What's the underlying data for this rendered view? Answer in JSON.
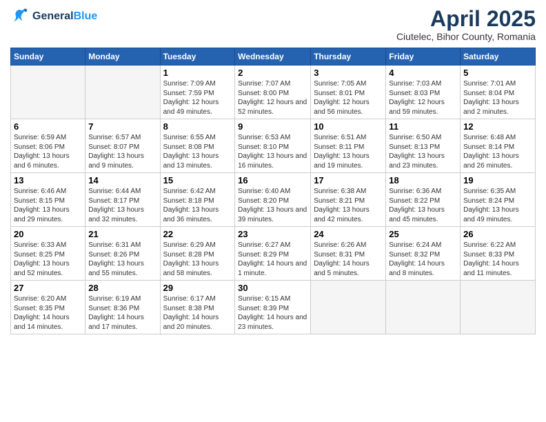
{
  "header": {
    "logo_line1": "General",
    "logo_line2": "Blue",
    "month": "April 2025",
    "location": "Ciutelec, Bihor County, Romania"
  },
  "days_of_week": [
    "Sunday",
    "Monday",
    "Tuesday",
    "Wednesday",
    "Thursday",
    "Friday",
    "Saturday"
  ],
  "weeks": [
    [
      {
        "day": "",
        "info": ""
      },
      {
        "day": "",
        "info": ""
      },
      {
        "day": "1",
        "info": "Sunrise: 7:09 AM\nSunset: 7:59 PM\nDaylight: 12 hours and 49 minutes."
      },
      {
        "day": "2",
        "info": "Sunrise: 7:07 AM\nSunset: 8:00 PM\nDaylight: 12 hours and 52 minutes."
      },
      {
        "day": "3",
        "info": "Sunrise: 7:05 AM\nSunset: 8:01 PM\nDaylight: 12 hours and 56 minutes."
      },
      {
        "day": "4",
        "info": "Sunrise: 7:03 AM\nSunset: 8:03 PM\nDaylight: 12 hours and 59 minutes."
      },
      {
        "day": "5",
        "info": "Sunrise: 7:01 AM\nSunset: 8:04 PM\nDaylight: 13 hours and 2 minutes."
      }
    ],
    [
      {
        "day": "6",
        "info": "Sunrise: 6:59 AM\nSunset: 8:06 PM\nDaylight: 13 hours and 6 minutes."
      },
      {
        "day": "7",
        "info": "Sunrise: 6:57 AM\nSunset: 8:07 PM\nDaylight: 13 hours and 9 minutes."
      },
      {
        "day": "8",
        "info": "Sunrise: 6:55 AM\nSunset: 8:08 PM\nDaylight: 13 hours and 13 minutes."
      },
      {
        "day": "9",
        "info": "Sunrise: 6:53 AM\nSunset: 8:10 PM\nDaylight: 13 hours and 16 minutes."
      },
      {
        "day": "10",
        "info": "Sunrise: 6:51 AM\nSunset: 8:11 PM\nDaylight: 13 hours and 19 minutes."
      },
      {
        "day": "11",
        "info": "Sunrise: 6:50 AM\nSunset: 8:13 PM\nDaylight: 13 hours and 23 minutes."
      },
      {
        "day": "12",
        "info": "Sunrise: 6:48 AM\nSunset: 8:14 PM\nDaylight: 13 hours and 26 minutes."
      }
    ],
    [
      {
        "day": "13",
        "info": "Sunrise: 6:46 AM\nSunset: 8:15 PM\nDaylight: 13 hours and 29 minutes."
      },
      {
        "day": "14",
        "info": "Sunrise: 6:44 AM\nSunset: 8:17 PM\nDaylight: 13 hours and 32 minutes."
      },
      {
        "day": "15",
        "info": "Sunrise: 6:42 AM\nSunset: 8:18 PM\nDaylight: 13 hours and 36 minutes."
      },
      {
        "day": "16",
        "info": "Sunrise: 6:40 AM\nSunset: 8:20 PM\nDaylight: 13 hours and 39 minutes."
      },
      {
        "day": "17",
        "info": "Sunrise: 6:38 AM\nSunset: 8:21 PM\nDaylight: 13 hours and 42 minutes."
      },
      {
        "day": "18",
        "info": "Sunrise: 6:36 AM\nSunset: 8:22 PM\nDaylight: 13 hours and 45 minutes."
      },
      {
        "day": "19",
        "info": "Sunrise: 6:35 AM\nSunset: 8:24 PM\nDaylight: 13 hours and 49 minutes."
      }
    ],
    [
      {
        "day": "20",
        "info": "Sunrise: 6:33 AM\nSunset: 8:25 PM\nDaylight: 13 hours and 52 minutes."
      },
      {
        "day": "21",
        "info": "Sunrise: 6:31 AM\nSunset: 8:26 PM\nDaylight: 13 hours and 55 minutes."
      },
      {
        "day": "22",
        "info": "Sunrise: 6:29 AM\nSunset: 8:28 PM\nDaylight: 13 hours and 58 minutes."
      },
      {
        "day": "23",
        "info": "Sunrise: 6:27 AM\nSunset: 8:29 PM\nDaylight: 14 hours and 1 minute."
      },
      {
        "day": "24",
        "info": "Sunrise: 6:26 AM\nSunset: 8:31 PM\nDaylight: 14 hours and 5 minutes."
      },
      {
        "day": "25",
        "info": "Sunrise: 6:24 AM\nSunset: 8:32 PM\nDaylight: 14 hours and 8 minutes."
      },
      {
        "day": "26",
        "info": "Sunrise: 6:22 AM\nSunset: 8:33 PM\nDaylight: 14 hours and 11 minutes."
      }
    ],
    [
      {
        "day": "27",
        "info": "Sunrise: 6:20 AM\nSunset: 8:35 PM\nDaylight: 14 hours and 14 minutes."
      },
      {
        "day": "28",
        "info": "Sunrise: 6:19 AM\nSunset: 8:36 PM\nDaylight: 14 hours and 17 minutes."
      },
      {
        "day": "29",
        "info": "Sunrise: 6:17 AM\nSunset: 8:38 PM\nDaylight: 14 hours and 20 minutes."
      },
      {
        "day": "30",
        "info": "Sunrise: 6:15 AM\nSunset: 8:39 PM\nDaylight: 14 hours and 23 minutes."
      },
      {
        "day": "",
        "info": ""
      },
      {
        "day": "",
        "info": ""
      },
      {
        "day": "",
        "info": ""
      }
    ]
  ]
}
